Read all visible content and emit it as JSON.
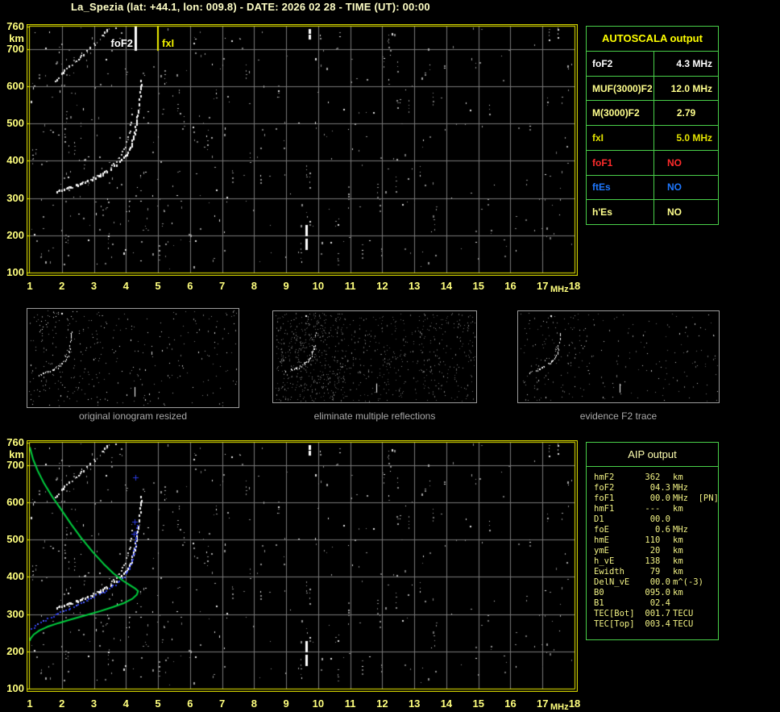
{
  "title": "La_Spezia (lat: +44.1, lon: 009.8) - DATE: 2026 02 28 - TIME (UT): 00:00",
  "autoscala_table": {
    "header": "AUTOSCALA output",
    "rows": [
      {
        "label": "foF2",
        "value": "4.3 MHz",
        "color": "#FFFFFF",
        "value_align": "right"
      },
      {
        "label": "MUF(3000)F2",
        "value": "12.0 MHz",
        "color": "#FFFF8C",
        "value_align": "right"
      },
      {
        "label": "M(3000)F2",
        "value": "2.79",
        "color": "#FFFF8C",
        "value_align": "center"
      },
      {
        "label": "fxI",
        "value": "5.0 MHz",
        "color": "#E3E300",
        "value_align": "right"
      },
      {
        "label": "foF1",
        "value": "NO",
        "color": "#FF2B2B",
        "value_align": "left"
      },
      {
        "label": "ftEs",
        "value": "NO",
        "color": "#1E78FF",
        "value_align": "left"
      },
      {
        "label": "h'Es",
        "value": "NO",
        "color": "#FFFF8C",
        "value_align": "left"
      }
    ]
  },
  "aip_table": {
    "header": "AIP output",
    "rows": [
      {
        "name": "hmF2",
        "value": "362",
        "unit": "km"
      },
      {
        "name": "foF2",
        "value": "04.3",
        "unit": "MHz"
      },
      {
        "name": "foF1",
        "value": "00.0",
        "unit": "MHz  [PN]"
      },
      {
        "name": "hmF1",
        "value": "---",
        "unit": "km"
      },
      {
        "name": "D1",
        "value": "00.0",
        "unit": ""
      },
      {
        "name": "foE",
        "value": "0.6",
        "unit": "MHz"
      },
      {
        "name": "hmE",
        "value": "110",
        "unit": "km"
      },
      {
        "name": "ymE",
        "value": "20",
        "unit": "km"
      },
      {
        "name": "h_vE",
        "value": "138",
        "unit": "km"
      },
      {
        "name": "Ewidth",
        "value": "79",
        "unit": "km"
      },
      {
        "name": "DelN_vE",
        "value": "00.0",
        "unit": "m^(-3)"
      },
      {
        "name": "B0",
        "value": "095.0",
        "unit": "km"
      },
      {
        "name": "B1",
        "value": "02.4",
        "unit": ""
      },
      {
        "name": "TEC[Bot]",
        "value": "001.7",
        "unit": "TECU"
      },
      {
        "name": "TEC[Top]",
        "value": "003.4",
        "unit": "TECU"
      }
    ]
  },
  "thumbnails": [
    {
      "caption": "original ionogram resized",
      "show_second_hop": true,
      "noise_count": 340,
      "noise_style": "coarse",
      "seed": 11
    },
    {
      "caption": "eliminate multiple reflections",
      "show_second_hop": false,
      "noise_count": 950,
      "noise_style": "fine",
      "seed": 22
    },
    {
      "caption": "evidence F2 trace",
      "show_second_hop": false,
      "noise_count": 260,
      "noise_style": "sparse",
      "seed": 33
    }
  ],
  "chart_data": [
    {
      "id": "top-ionogram",
      "type": "scatter",
      "xlabel": "MHz",
      "ylabel": "km",
      "xlim": [
        1,
        18
      ],
      "ylim": [
        100,
        760
      ],
      "xticks": [
        1,
        2,
        3,
        4,
        5,
        6,
        7,
        8,
        9,
        10,
        11,
        12,
        13,
        14,
        15,
        16,
        17,
        18
      ],
      "yticks": [
        760,
        700,
        600,
        500,
        400,
        300,
        200,
        100
      ],
      "grid": true,
      "markers": [
        {
          "label": "foF2",
          "x": 4.3,
          "color": "#FFFFFF"
        },
        {
          "label": "fxI",
          "x": 5.0,
          "color": "#F0F000"
        }
      ],
      "f2_trace": [
        [
          1.85,
          318
        ],
        [
          2.1,
          326
        ],
        [
          2.4,
          335
        ],
        [
          2.7,
          345
        ],
        [
          3.0,
          356
        ],
        [
          3.3,
          369
        ],
        [
          3.55,
          383
        ],
        [
          3.8,
          400
        ],
        [
          4.0,
          420
        ],
        [
          4.15,
          444
        ],
        [
          4.25,
          472
        ],
        [
          4.33,
          505
        ],
        [
          4.38,
          540
        ],
        [
          4.42,
          572
        ],
        [
          4.45,
          600
        ],
        [
          4.47,
          618
        ]
      ],
      "second_hop": [
        [
          1.8,
          618
        ],
        [
          3.42,
          753
        ]
      ],
      "interference": [
        {
          "x": 9.62,
          "y1": 162,
          "y2": 228
        },
        {
          "x": 9.72,
          "y1": 726,
          "y2": 754
        }
      ],
      "noise_seed": 7,
      "noise_count": 620
    },
    {
      "id": "bottom-ionogram",
      "type": "scatter",
      "xlabel": "MHz",
      "ylabel": "km",
      "xlim": [
        1,
        18
      ],
      "ylim": [
        100,
        760
      ],
      "xticks": [
        1,
        2,
        3,
        4,
        5,
        6,
        7,
        8,
        9,
        10,
        11,
        12,
        13,
        14,
        15,
        16,
        17,
        18
      ],
      "yticks": [
        760,
        700,
        600,
        500,
        400,
        300,
        200,
        100
      ],
      "grid": true,
      "f2_trace": [
        [
          1.85,
          318
        ],
        [
          2.1,
          326
        ],
        [
          2.4,
          335
        ],
        [
          2.7,
          345
        ],
        [
          3.0,
          356
        ],
        [
          3.3,
          369
        ],
        [
          3.55,
          383
        ],
        [
          3.8,
          400
        ],
        [
          4.0,
          420
        ],
        [
          4.15,
          444
        ],
        [
          4.25,
          472
        ],
        [
          4.33,
          505
        ],
        [
          4.38,
          540
        ],
        [
          4.42,
          572
        ],
        [
          4.45,
          600
        ],
        [
          4.47,
          618
        ]
      ],
      "second_hop": [
        [
          1.8,
          618
        ],
        [
          3.42,
          753
        ]
      ],
      "interference": [
        {
          "x": 9.62,
          "y1": 162,
          "y2": 228
        },
        {
          "x": 9.72,
          "y1": 726,
          "y2": 754
        }
      ],
      "profile_green": [
        [
          1.0,
          748
        ],
        [
          1.1,
          716
        ],
        [
          1.25,
          684
        ],
        [
          1.45,
          650
        ],
        [
          1.7,
          615
        ],
        [
          2.0,
          578
        ],
        [
          2.3,
          540
        ],
        [
          2.6,
          505
        ],
        [
          2.95,
          468
        ],
        [
          3.3,
          435
        ],
        [
          3.6,
          410
        ],
        [
          3.9,
          390
        ],
        [
          4.15,
          376
        ],
        [
          4.3,
          368
        ],
        [
          4.38,
          362
        ],
        [
          4.34,
          352
        ],
        [
          4.2,
          341
        ],
        [
          3.95,
          330
        ],
        [
          3.6,
          319
        ],
        [
          3.2,
          308
        ],
        [
          2.75,
          297
        ],
        [
          2.3,
          286
        ],
        [
          1.9,
          276
        ],
        [
          1.55,
          266
        ],
        [
          1.3,
          256
        ],
        [
          1.12,
          245
        ],
        [
          1.02,
          234
        ],
        [
          1.0,
          228
        ]
      ],
      "profile_color": "#00CE3E",
      "trace_blue": [
        [
          1.02,
          262
        ],
        [
          1.25,
          275
        ],
        [
          1.5,
          287
        ],
        [
          1.75,
          298
        ],
        [
          2.0,
          308
        ],
        [
          2.3,
          320
        ],
        [
          2.6,
          332
        ],
        [
          2.9,
          344
        ],
        [
          3.2,
          357
        ],
        [
          3.5,
          372
        ],
        [
          3.75,
          388
        ],
        [
          3.95,
          406
        ],
        [
          4.1,
          426
        ],
        [
          4.2,
          450
        ],
        [
          4.26,
          478
        ],
        [
          4.3,
          508
        ],
        [
          4.32,
          540
        ]
      ],
      "trace_blue_color": "#2B3BE0",
      "blue_plus": [
        [
          4.24,
          515
        ],
        [
          4.26,
          548
        ],
        [
          4.3,
          667
        ]
      ],
      "noise_seed": 7,
      "noise_count": 620
    }
  ]
}
